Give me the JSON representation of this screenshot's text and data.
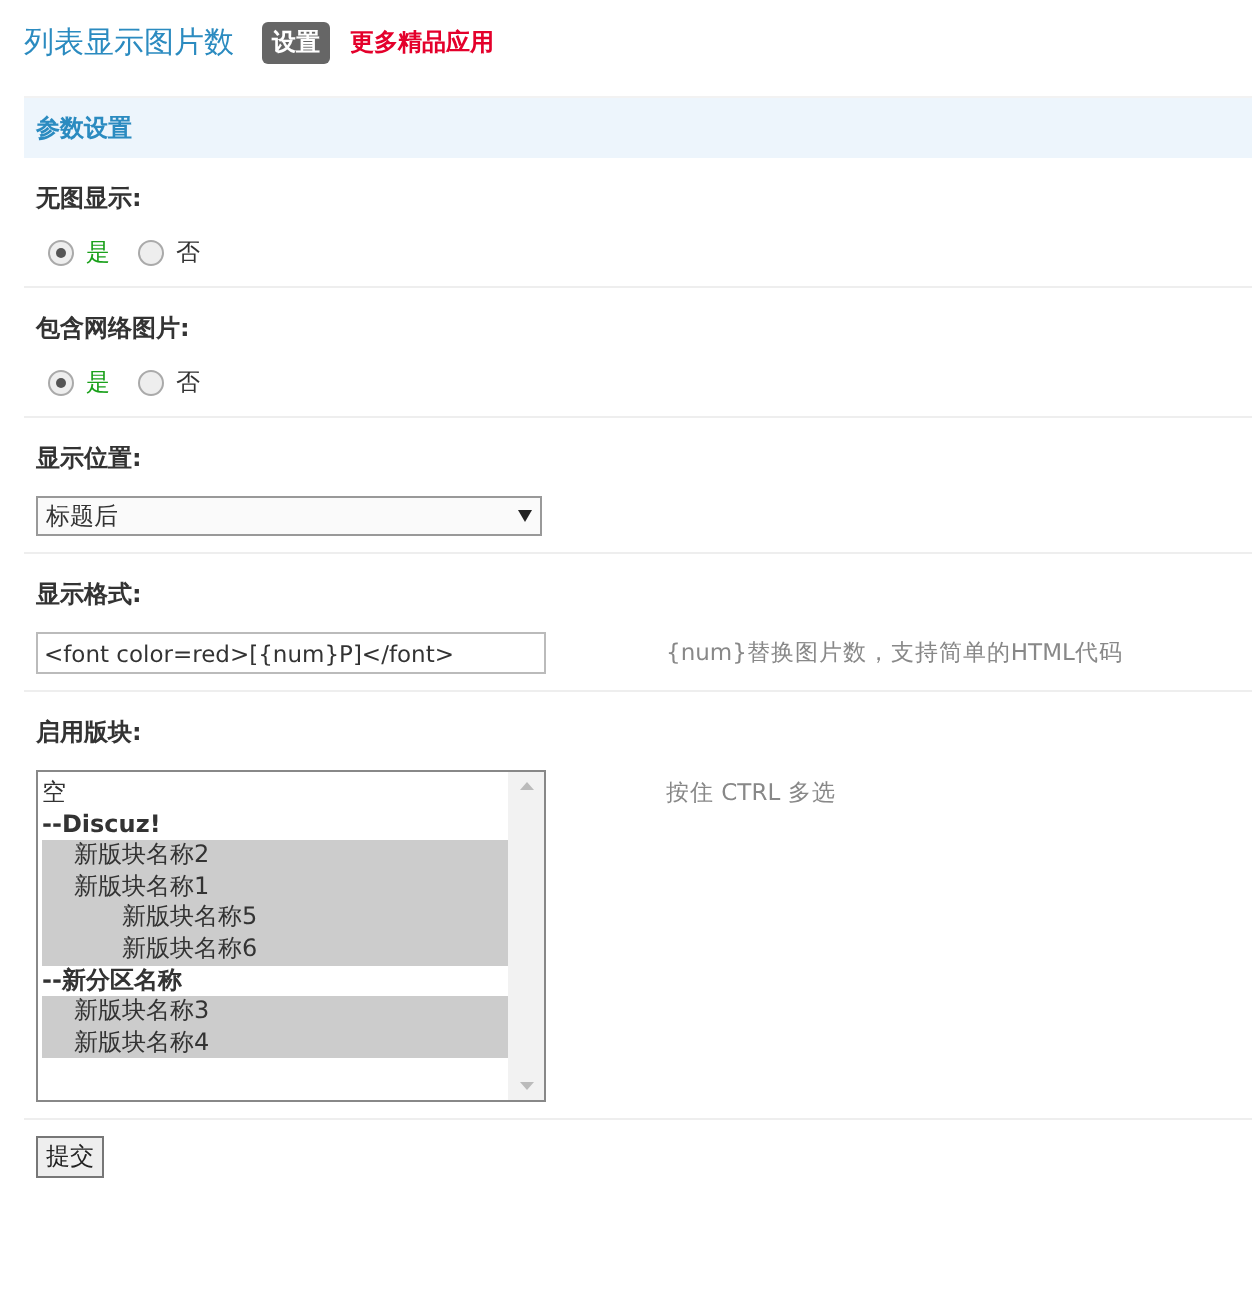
{
  "header": {
    "title": "列表显示图片数",
    "tabs": [
      {
        "label": "设置",
        "selected": true
      },
      {
        "label": "更多精品应用",
        "selected": false
      }
    ]
  },
  "section": {
    "title": "参数设置"
  },
  "settings": [
    {
      "kind": "radio",
      "label": "无图显示:",
      "options": [
        {
          "label": "是",
          "selected": true
        },
        {
          "label": "否",
          "selected": false
        }
      ]
    },
    {
      "kind": "radio",
      "label": "包含网络图片:",
      "options": [
        {
          "label": "是",
          "selected": true
        },
        {
          "label": "否",
          "selected": false
        }
      ]
    },
    {
      "kind": "select",
      "label": "显示位置:",
      "value": "标题后"
    },
    {
      "kind": "text",
      "label": "显示格式:",
      "value": "<font color=red>[{num}P]</font>",
      "hint": "{num}替换图片数，支持简单的HTML代码"
    },
    {
      "kind": "multiselect",
      "label": "启用版块:",
      "hint": "按住 CTRL 多选",
      "items": [
        {
          "kind": "option",
          "label": "空",
          "selected": false
        },
        {
          "kind": "group",
          "label": "--Discuz!",
          "selected": false,
          "children": [
            {
              "kind": "option",
              "label": "新版块名称2",
              "selected": true
            },
            {
              "kind": "option",
              "label": "新版块名称1",
              "selected": true,
              "children": [
                {
                  "kind": "option",
                  "label": "新版块名称5",
                  "selected": true
                },
                {
                  "kind": "option",
                  "label": "新版块名称6",
                  "selected": true
                }
              ]
            }
          ]
        },
        {
          "kind": "group",
          "label": "--新分区名称",
          "selected": false,
          "children": [
            {
              "kind": "option",
              "label": "新版块名称3",
              "selected": true
            },
            {
              "kind": "option",
              "label": "新版块名称4",
              "selected": true
            }
          ]
        }
      ]
    }
  ],
  "submit": {
    "label": "提交"
  }
}
